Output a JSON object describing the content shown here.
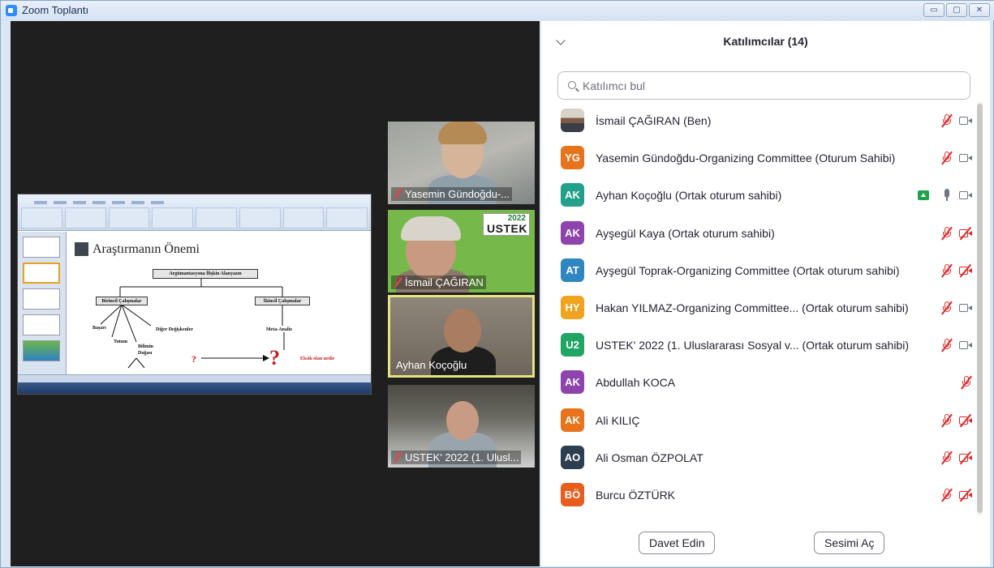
{
  "window": {
    "title": "Zoom Toplantı",
    "buttons": [
      "▭",
      "▢",
      "✕"
    ]
  },
  "slide": {
    "title": "Araştırmanın Önemi",
    "top_box": "Argümantasyona İlişkin Alanyazın",
    "left_box": "Birincil Çalışmalar",
    "right_box": "İkincil Çalışmalar",
    "items": {
      "basari": "Başarı",
      "tutum": "Tutum",
      "bilimin_dogasi": "Bilimin Doğası",
      "diger": "Diğer Değişkenler",
      "meta": "Meta-Analiz",
      "eksik": "Eksik olan nedir",
      "question": "?"
    }
  },
  "tiles": [
    {
      "name": "Yasemin Gündoğdu-..."
    },
    {
      "name": "İsmail ÇAĞIRAN",
      "logo_year": "2022",
      "logo_name": "USTEK"
    },
    {
      "name": "Ayhan Koçoğlu"
    },
    {
      "name": "USTEK' 2022 (1. Ulusl..."
    }
  ],
  "panel": {
    "title": "Katılımcılar (14)",
    "search_placeholder": "Katılımcı bul",
    "participants": [
      {
        "initials": "",
        "photo": true,
        "color": "#7d5a45",
        "name": "İsmail ÇAĞIRAN (Ben)",
        "mic": "muted",
        "cam": "on"
      },
      {
        "initials": "YG",
        "color": "#e8731d",
        "name": "Yasemin Gündoğdu-Organizing Committee (Oturum Sahibi)",
        "mic": "muted",
        "cam": "on"
      },
      {
        "initials": "AK",
        "color": "#23a08a",
        "name": "Ayhan Koçoğlu (Ortak oturum sahibi)",
        "mic": "on",
        "cam": "on",
        "sharing": true
      },
      {
        "initials": "AK",
        "color": "#8e44ad",
        "name": "Ayşegül Kaya (Ortak oturum sahibi)",
        "mic": "muted",
        "cam": "off"
      },
      {
        "initials": "AT",
        "color": "#2f86c1",
        "name": "Ayşegül Toprak-Organizing Committee (Ortak oturum sahibi)",
        "mic": "muted",
        "cam": "off"
      },
      {
        "initials": "HY",
        "color": "#f0a31c",
        "name": "Hakan YILMAZ-Organizing Committee...  (Ortak oturum sahibi)",
        "mic": "muted",
        "cam": "on"
      },
      {
        "initials": "U2",
        "color": "#20a565",
        "name": "USTEK' 2022 (1. Uluslararası Sosyal v...  (Ortak oturum sahibi)",
        "mic": "muted",
        "cam": "on"
      },
      {
        "initials": "AK",
        "color": "#8e44ad",
        "name": "Abdullah KOCA",
        "mic": "muted",
        "cam": "none"
      },
      {
        "initials": "AK",
        "color": "#e8731d",
        "name": "Ali KILIÇ",
        "mic": "muted",
        "cam": "off"
      },
      {
        "initials": "AO",
        "color": "#2c3e50",
        "name": "Ali Osman ÖZPOLAT",
        "mic": "muted",
        "cam": "off"
      },
      {
        "initials": "BÖ",
        "color": "#e85d1d",
        "name": "Burcu ÖZTÜRK",
        "mic": "muted",
        "cam": "off"
      }
    ],
    "invite_label": "Davet Edin",
    "unmute_label": "Sesimi Aç"
  }
}
